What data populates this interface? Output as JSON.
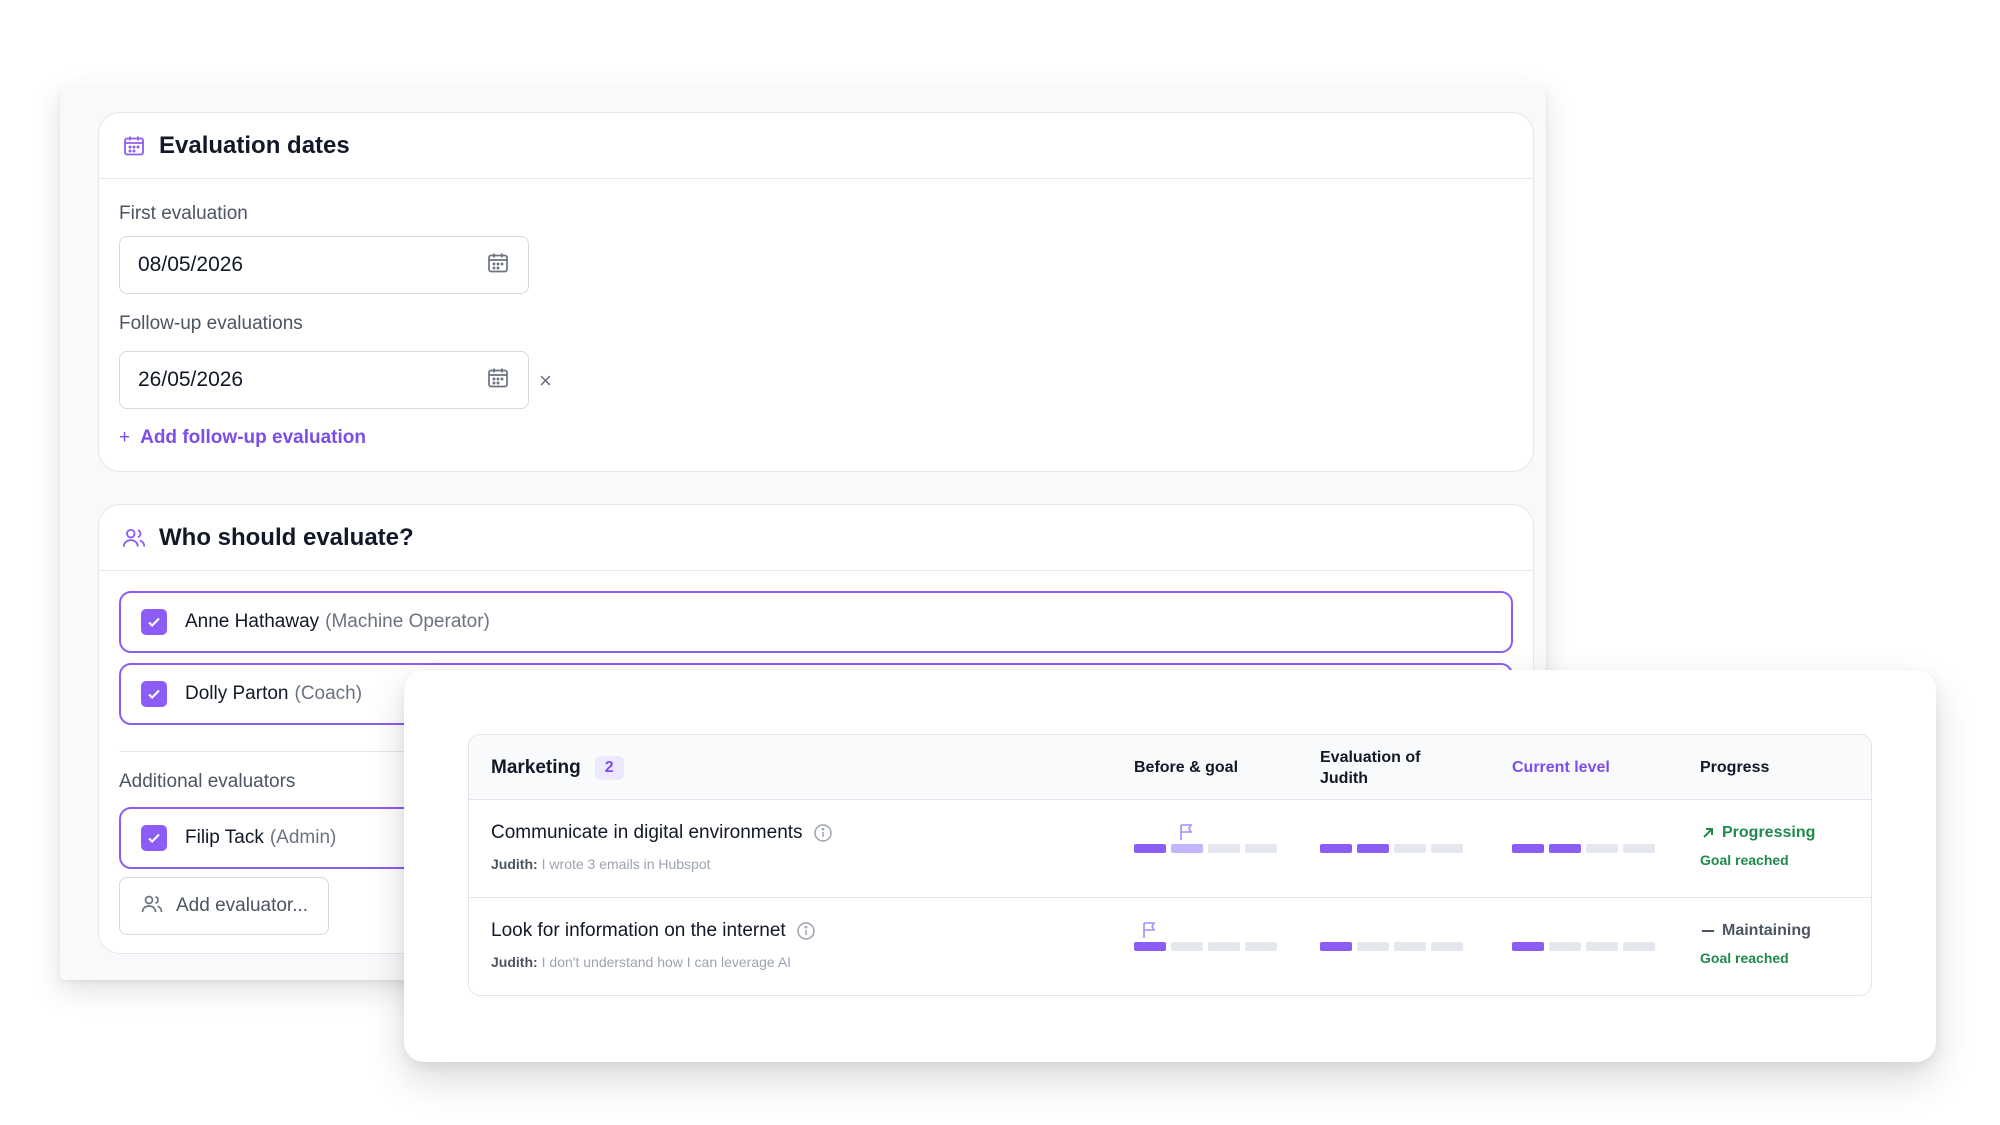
{
  "evaluation_dates": {
    "title": "Evaluation dates",
    "first_label": "First evaluation",
    "first_value": "08/05/2026",
    "followup_label": "Follow-up evaluations",
    "followup_value": "26/05/2026",
    "remove_symbol": "×",
    "add_followup_label": "Add follow-up evaluation",
    "add_symbol": "+"
  },
  "evaluators": {
    "title": "Who should evaluate?",
    "list": [
      {
        "name": "Anne Hathaway",
        "role": "(Machine Operator)",
        "checked": true
      },
      {
        "name": "Dolly Parton",
        "role": "(Coach)",
        "checked": true
      }
    ],
    "additional_label": "Additional evaluators",
    "additional": [
      {
        "name": "Filip Tack",
        "role": "(Admin)",
        "checked": true
      }
    ],
    "add_evaluator_label": "Add evaluator..."
  },
  "skills_table": {
    "category": "Marketing",
    "count": "2",
    "columns": {
      "before_goal": "Before & goal",
      "evaluation_line1": "Evaluation of",
      "evaluation_line2": "Judith",
      "current_level": "Current level",
      "progress": "Progress"
    },
    "rows": [
      {
        "skill": "Communicate in digital environments",
        "commenter": "Judith:",
        "comment": "I wrote 3 emails in Hubspot",
        "before_level": 1,
        "goal_level": 2,
        "evaluation_level": 2,
        "current_level": 2,
        "status": "Progressing",
        "status_icon": "arrow-up-right-icon",
        "status_color": "#1f8a4c",
        "sub_status": "Goal reached"
      },
      {
        "skill": "Look for information on the internet",
        "commenter": "Judith:",
        "comment": "I don't understand how I can leverage AI",
        "before_level": 1,
        "goal_level": 1,
        "evaluation_level": 1,
        "current_level": 1,
        "status": "Maintaining",
        "status_icon": "dash-icon",
        "status_color": "#4b5563",
        "sub_status": "Goal reached"
      }
    ],
    "max_level": 4
  },
  "colors": {
    "accent": "#8b5cf6",
    "accent_text": "#7c4dea",
    "goal_fill": "#c4b5fd",
    "empty_bar": "#e5e7ef",
    "success": "#1f8a4c"
  }
}
